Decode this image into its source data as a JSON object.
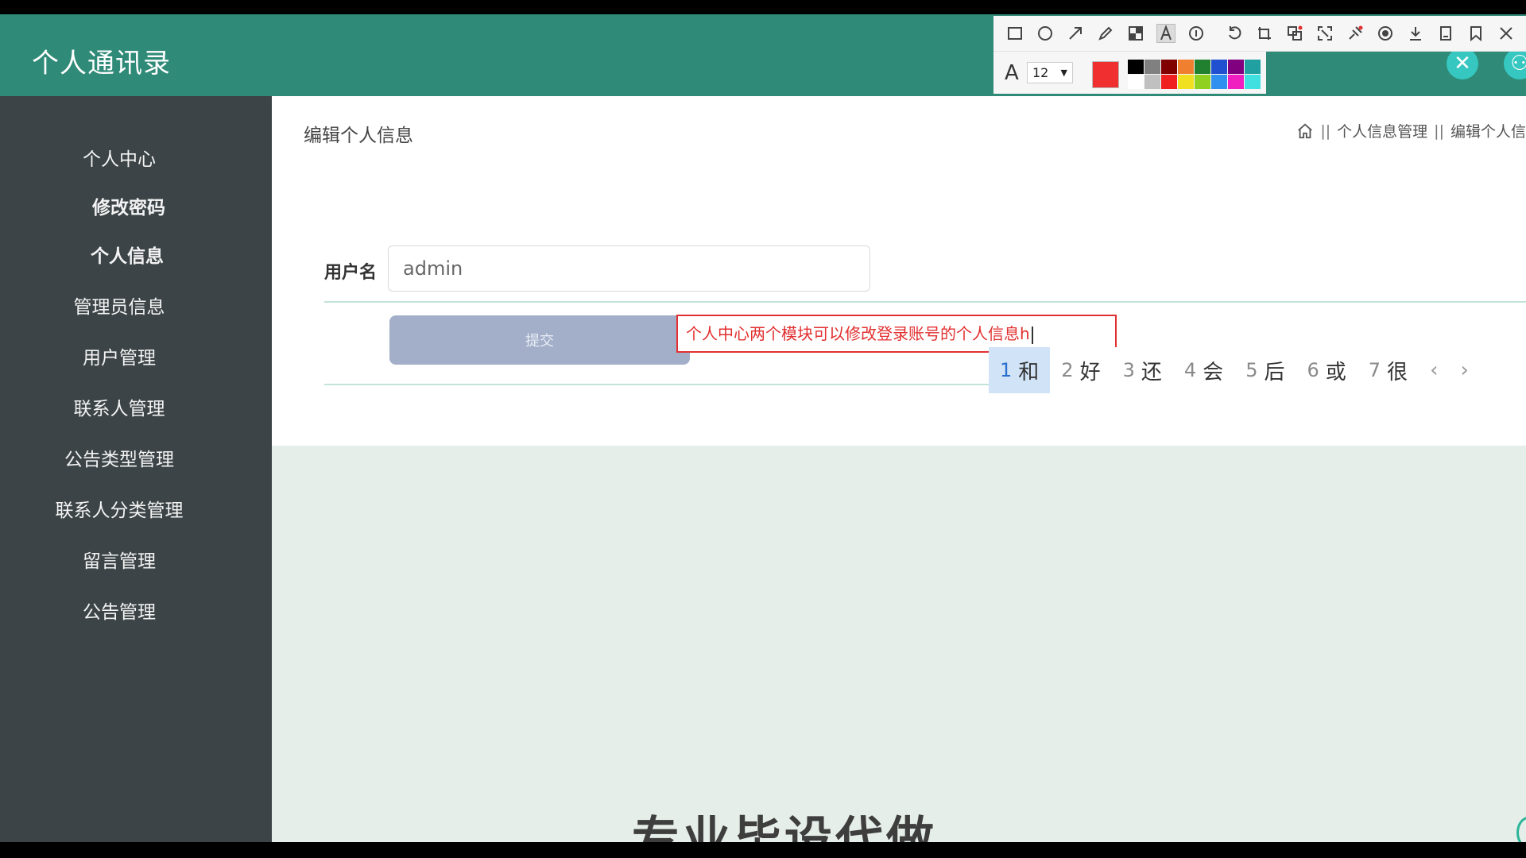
{
  "header": {
    "title": "个人通讯录"
  },
  "sidebar": {
    "items": [
      {
        "label": "个人中心"
      },
      {
        "label": "修改密码"
      },
      {
        "label": "个人信息"
      },
      {
        "label": "管理员信息"
      },
      {
        "label": "用户管理"
      },
      {
        "label": "联系人管理"
      },
      {
        "label": "公告类型管理"
      },
      {
        "label": "联系人分类管理"
      },
      {
        "label": "留言管理"
      },
      {
        "label": "公告管理"
      }
    ]
  },
  "main": {
    "page_title": "编辑个人信息",
    "breadcrumb": {
      "sep": "||",
      "items": [
        "个人信息管理",
        "编辑个人信"
      ]
    },
    "form": {
      "username_label": "用户名",
      "username_value": "admin",
      "submit_label": "提交"
    }
  },
  "watermark": {
    "text": "专业毕设代做"
  },
  "annotation_tool": {
    "font_size": "12",
    "current_color": "#f03030",
    "palette": [
      "#000000",
      "#808080",
      "#800000",
      "#f08030",
      "#208030",
      "#2050d0",
      "#800080",
      "#20a0a0",
      "#ffffff",
      "#c0c0c0",
      "#f02020",
      "#f0e020",
      "#90d020",
      "#3090f0",
      "#f020c0",
      "#40e0e0"
    ],
    "tools": [
      "rectangle-icon",
      "ellipse-icon",
      "arrow-icon",
      "pencil-icon",
      "mosaic-icon",
      "text-icon",
      "number-icon",
      "undo-icon",
      "crop-icon",
      "translate-icon",
      "expand-icon",
      "pin-icon",
      "record-icon",
      "download-icon",
      "save-icon",
      "bookmark-icon",
      "close-icon"
    ],
    "text_content": "个人中心两个模块可以修改登录账号的个人信息h"
  },
  "ime": {
    "candidates": [
      {
        "num": "1",
        "char": "和"
      },
      {
        "num": "2",
        "char": "好"
      },
      {
        "num": "3",
        "char": "还"
      },
      {
        "num": "4",
        "char": "会"
      },
      {
        "num": "5",
        "char": "后"
      },
      {
        "num": "6",
        "char": "或"
      },
      {
        "num": "7",
        "char": "很"
      }
    ],
    "prev": "‹",
    "next": "›"
  }
}
